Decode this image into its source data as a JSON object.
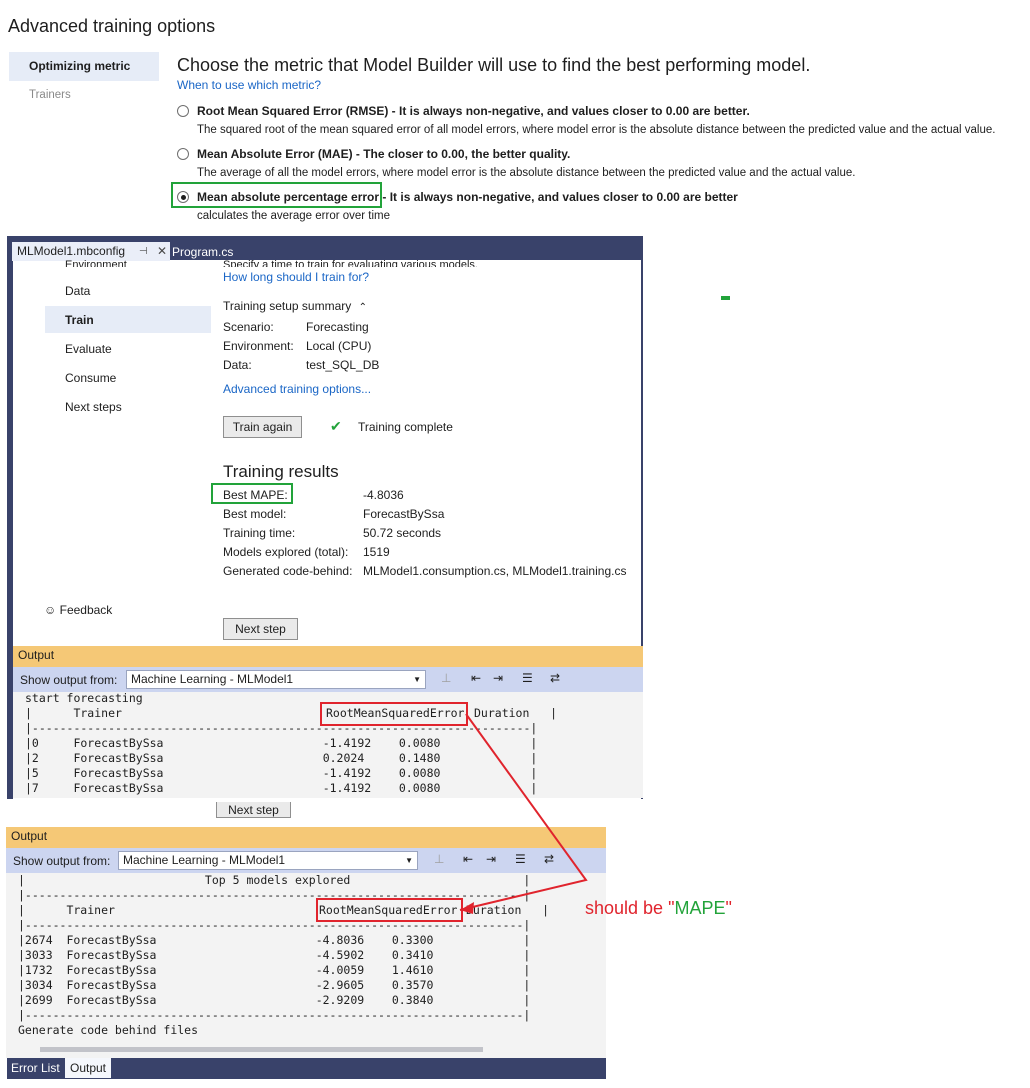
{
  "advanced": {
    "title": "Advanced training options",
    "nav": [
      "Optimizing metric",
      "Trainers"
    ],
    "heading": "Choose the metric that Model Builder will use to find the best performing model.",
    "link": "When to use which metric?",
    "options": [
      {
        "label": "Root Mean Squared Error (RMSE) - It is always non-negative, and values closer to 0.00 are better.",
        "desc": "The squared root of the mean squared error of all model errors, where model error is the absolute distance between the predicted value and the actual value.",
        "selected": false
      },
      {
        "label": "Mean Absolute Error (MAE) - The closer to 0.00, the better quality.",
        "desc": "The average of all the model errors, where model error is the absolute distance between the predicted value and the actual value.",
        "selected": false
      },
      {
        "label": "Mean absolute percentage error - It is always non-negative, and values closer to 0.00 are better",
        "desc": "calculates the average error over time",
        "selected": true
      }
    ]
  },
  "builder": {
    "tabs": {
      "active": "MLModel1.mbconfig",
      "other": "Program.cs",
      "pin": "⊣",
      "close": "✕"
    },
    "cut_top_left": "Environment",
    "cut_top_right": "Specify a time to train for evaluating various models.",
    "sidebar": [
      "Data",
      "Train",
      "Evaluate",
      "Consume",
      "Next steps"
    ],
    "feedback": "Feedback",
    "train_link": "How long should I train for?",
    "summary": {
      "title": "Training setup summary",
      "rows": [
        {
          "k": "Scenario:",
          "v": "Forecasting"
        },
        {
          "k": "Environment:",
          "v": "Local (CPU)"
        },
        {
          "k": "Data:",
          "v": "test_SQL_DB"
        }
      ],
      "adv_link": "Advanced training options..."
    },
    "train_again": "Train again",
    "status": "Training complete",
    "results": {
      "title": "Training results",
      "rows": [
        {
          "k": "Best MAPE:",
          "v": "-4.8036"
        },
        {
          "k": "Best model:",
          "v": "ForecastBySsa"
        },
        {
          "k": "Training time:",
          "v": "50.72 seconds"
        },
        {
          "k": "Models explored (total):",
          "v": "1519"
        },
        {
          "k": "Generated code-behind:",
          "v": "MLModel1.consumption.cs, MLModel1.training.cs"
        }
      ]
    },
    "next_step": "Next step"
  },
  "output1": {
    "header": "Output",
    "show_from": "Show output from:",
    "source": "Machine Learning - MLModel1",
    "lines": [
      "start forecasting",
      "|      Trainer                            ",
      "|------------------------------------------------------------------------|",
      "|0     ForecastBySsa                       -1.4192    0.0080             |",
      "|2     ForecastBySsa                       0.2024     0.1480             |",
      "|5     ForecastBySsa                       -1.4192    0.0080             |",
      "|7     ForecastBySsa                       -1.4192    0.0080             |"
    ],
    "col_metric": "RootMeanSquaredError",
    "col_duration": "Duration   |"
  },
  "output2": {
    "next_step": "Next step",
    "header": "Output",
    "show_from": "Show output from:",
    "source": "Machine Learning - MLModel1",
    "lines": [
      "|                          Top 5 models explored                         |",
      "|------------------------------------------------------------------------|",
      "|      Trainer                            ",
      "|------------------------------------------------------------------------|",
      "|2674  ForecastBySsa                       -4.8036    0.3300             |",
      "|3033  ForecastBySsa                       -4.5902    0.3410             |",
      "|1732  ForecastBySsa                       -4.0059    1.4610             |",
      "|3034  ForecastBySsa                       -2.9605    0.3570             |",
      "|2699  ForecastBySsa                       -2.9209    0.3840             |",
      "|------------------------------------------------------------------------|",
      "Generate code behind files"
    ],
    "col_metric": "RootMeanSquaredError",
    "col_duration": "Duration   |"
  },
  "bottom_tabs": [
    "Error List",
    "Output"
  ],
  "annotation": {
    "prefix": "should be \"",
    "highlight": "MAPE",
    "suffix": "\""
  },
  "colors": {
    "accent_green": "#22a33a",
    "annotation_red": "#e0242d",
    "vs_navy": "#39426a",
    "output_header": "#f5c876"
  }
}
